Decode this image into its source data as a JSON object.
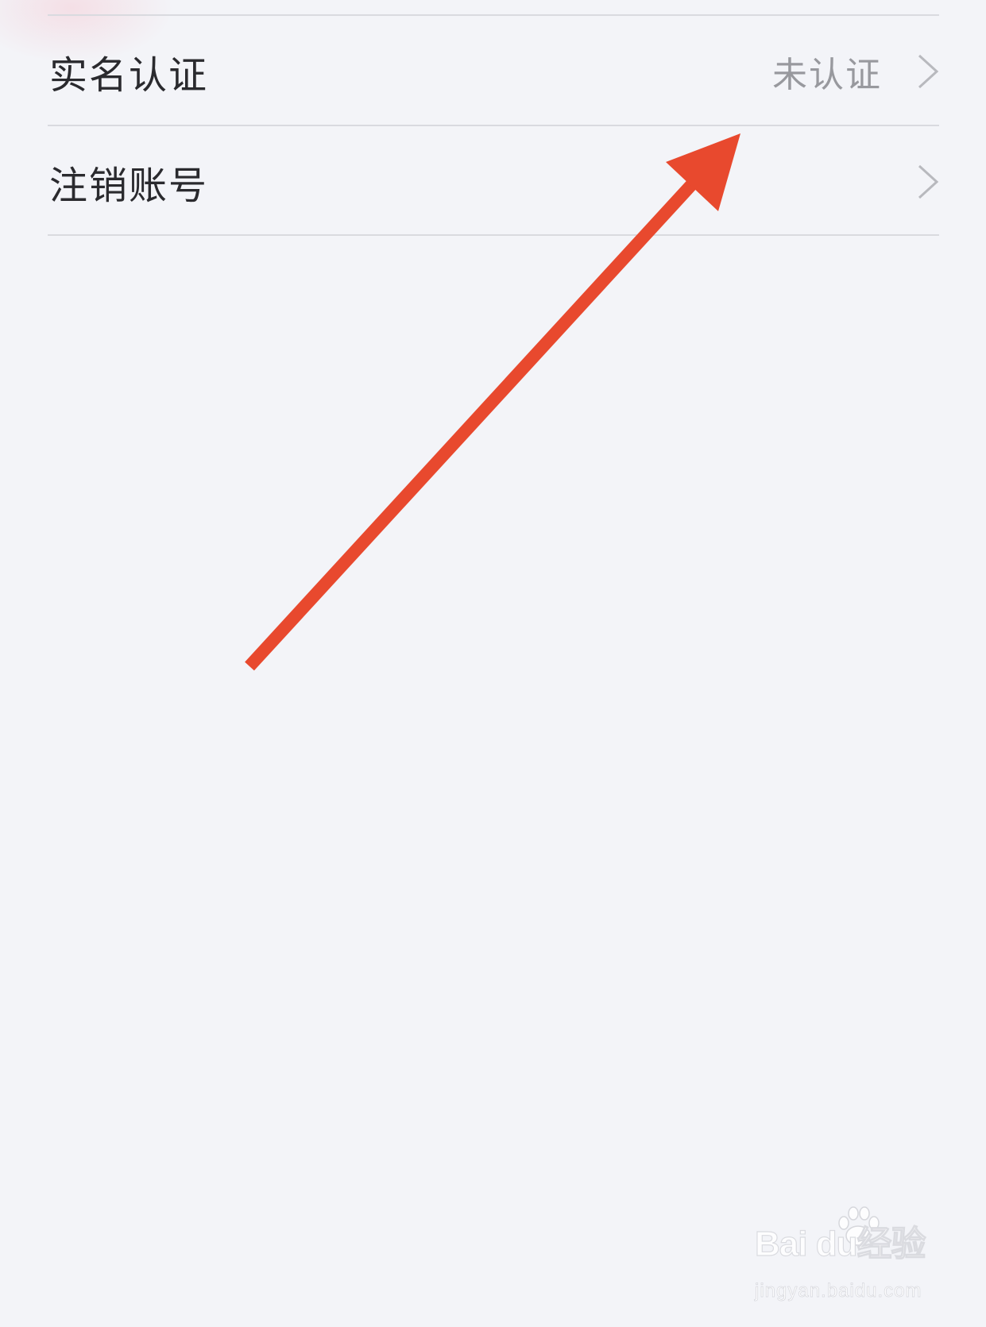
{
  "settings": {
    "items": [
      {
        "label": "实名认证",
        "value": "未认证"
      },
      {
        "label": "注销账号",
        "value": ""
      }
    ]
  },
  "annotation": {
    "arrow_color": "#e8492e"
  },
  "watermark": {
    "brand": "Bai du经验",
    "url": "jingyan.baidu.com"
  },
  "colors": {
    "background": "#f3f4f8",
    "divider": "#d9dadf",
    "label_text": "#2a2a2e",
    "value_text": "#98999e",
    "chevron": "#b8b9be"
  }
}
